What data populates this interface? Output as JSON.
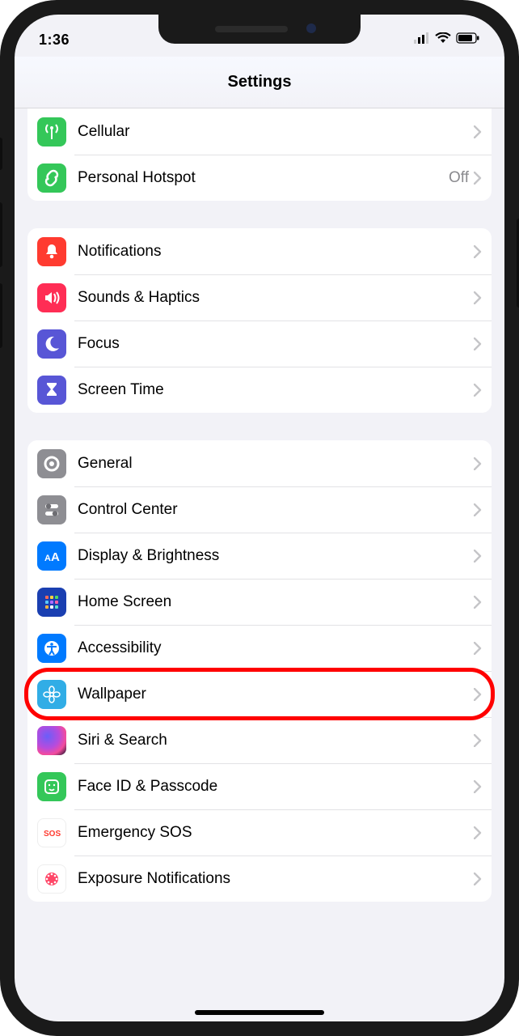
{
  "statusbar": {
    "time": "1:36"
  },
  "header": {
    "title": "Settings"
  },
  "groups": [
    {
      "id": "network",
      "rows": [
        {
          "id": "cellular",
          "label": "Cellular",
          "value": "",
          "icon": "antenna-icon",
          "color": "bg-green"
        },
        {
          "id": "hotspot",
          "label": "Personal Hotspot",
          "value": "Off",
          "icon": "link-icon",
          "color": "bg-green"
        }
      ]
    },
    {
      "id": "alerts",
      "rows": [
        {
          "id": "notifications",
          "label": "Notifications",
          "value": "",
          "icon": "bell-icon",
          "color": "bg-red"
        },
        {
          "id": "sounds",
          "label": "Sounds & Haptics",
          "value": "",
          "icon": "speaker-icon",
          "color": "bg-pink"
        },
        {
          "id": "focus",
          "label": "Focus",
          "value": "",
          "icon": "moon-icon",
          "color": "bg-purple"
        },
        {
          "id": "screentime",
          "label": "Screen Time",
          "value": "",
          "icon": "hourglass-icon",
          "color": "bg-purple"
        }
      ]
    },
    {
      "id": "system",
      "rows": [
        {
          "id": "general",
          "label": "General",
          "value": "",
          "icon": "gear-icon",
          "color": "bg-gray"
        },
        {
          "id": "controlcenter",
          "label": "Control Center",
          "value": "",
          "icon": "toggles-icon",
          "color": "bg-gray"
        },
        {
          "id": "display",
          "label": "Display & Brightness",
          "value": "",
          "icon": "textsize-icon",
          "color": "bg-blue"
        },
        {
          "id": "homescreen",
          "label": "Home Screen",
          "value": "",
          "icon": "appgrid-icon",
          "color": "bg-bluegrid"
        },
        {
          "id": "accessibility",
          "label": "Accessibility",
          "value": "",
          "icon": "accessibility-icon",
          "color": "bg-blue"
        },
        {
          "id": "wallpaper",
          "label": "Wallpaper",
          "value": "",
          "icon": "flower-icon",
          "color": "bg-cyan",
          "highlighted": true
        },
        {
          "id": "siri",
          "label": "Siri & Search",
          "value": "",
          "icon": "siri-icon",
          "color": "bg-siri"
        },
        {
          "id": "faceid",
          "label": "Face ID & Passcode",
          "value": "",
          "icon": "faceid-icon",
          "color": "bg-faceid"
        },
        {
          "id": "sos",
          "label": "Emergency SOS",
          "value": "",
          "icon": "sos-icon",
          "color": "bg-sos"
        },
        {
          "id": "exposure",
          "label": "Exposure Notifications",
          "value": "",
          "icon": "exposure-icon",
          "color": "bg-exposure"
        }
      ]
    }
  ],
  "highlight": {
    "target": "wallpaper"
  }
}
